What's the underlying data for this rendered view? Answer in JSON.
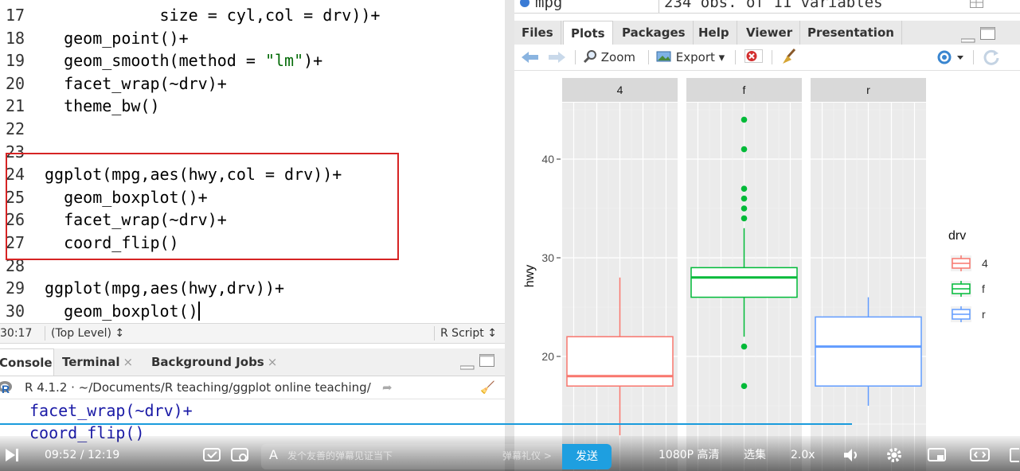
{
  "editor": {
    "lines": [
      {
        "num": "17",
        "code": "            size = cyl,col = drv))+",
        "top": 5
      },
      {
        "num": "18",
        "code": "  geom_point()+"
      },
      {
        "num": "19",
        "code": "  geom_smooth(method = \"lm\")+"
      },
      {
        "num": "20",
        "code": "  facet_wrap(~drv)+"
      },
      {
        "num": "21",
        "code": "  theme_bw()"
      },
      {
        "num": "22",
        "code": ""
      },
      {
        "num": "23",
        "code": ""
      },
      {
        "num": "24",
        "code": "ggplot(mpg,aes(hwy,col = drv))+"
      },
      {
        "num": "25",
        "code": "  geom_boxplot()+"
      },
      {
        "num": "26",
        "code": "  facet_wrap(~drv)+"
      },
      {
        "num": "27",
        "code": "  coord_flip()"
      },
      {
        "num": "28",
        "code": ""
      },
      {
        "num": "29",
        "code": "ggplot(mpg,aes(hwy,drv))+"
      },
      {
        "num": "30",
        "code": "  geom_boxplot()"
      }
    ],
    "status": {
      "position": "30:17",
      "scope": "(Top Level) ↕",
      "file_type": "R Script ↕"
    }
  },
  "console": {
    "tabs": [
      "Console",
      "Terminal",
      "Background Jobs"
    ],
    "path": "R 4.1.2 · ~/Documents/R teaching/ggplot online teaching/",
    "lines": [
      "facet_wrap(~drv)+",
      "coord_flip()"
    ]
  },
  "environment": {
    "name": "mpg",
    "summary": "234 obs. of 11 variables"
  },
  "files_pane": {
    "tabs": [
      "Files",
      "Plots",
      "Packages",
      "Help",
      "Viewer",
      "Presentation"
    ],
    "active_tab": "Plots",
    "toolbar": {
      "zoom": "Zoom",
      "export": "Export ▾"
    }
  },
  "chart_data": {
    "type": "boxplot",
    "ylabel": "hwy",
    "xlabel": "",
    "facets": [
      "4",
      "f",
      "r"
    ],
    "yticks": [
      20,
      30,
      40
    ],
    "ylim": [
      11,
      46
    ],
    "xlim": [
      -0.5,
      0.5
    ],
    "grid": true,
    "legend": {
      "title": "drv",
      "position": "right",
      "entries": [
        "4",
        "f",
        "r"
      ]
    },
    "colors": {
      "4": "#F8766D",
      "f": "#00BA38",
      "r": "#619CFF"
    },
    "boxes": [
      {
        "facet": "4",
        "q1": 17,
        "median": 18,
        "q3": 22,
        "whisker_low": 12,
        "whisker_high": 28,
        "outliers": []
      },
      {
        "facet": "f",
        "q1": 26,
        "median": 28,
        "q3": 29,
        "whisker_low": 22,
        "whisker_high": 33,
        "outliers": [
          17,
          21,
          34,
          35,
          36,
          37,
          41,
          44
        ]
      },
      {
        "facet": "r",
        "q1": 17,
        "median": 21,
        "q3": 24,
        "whisker_low": 15,
        "whisker_high": 26,
        "outliers": []
      }
    ]
  },
  "player": {
    "time": "09:52 / 12:19",
    "progress": 0.8,
    "danmaku_placeholder": "发个友善的弹幕见证当下",
    "danmaku_etiquette": "弹幕礼仪 >",
    "send": "发送",
    "quality": "1080P 高清",
    "episodes": "选集",
    "speed": "2.0x"
  }
}
